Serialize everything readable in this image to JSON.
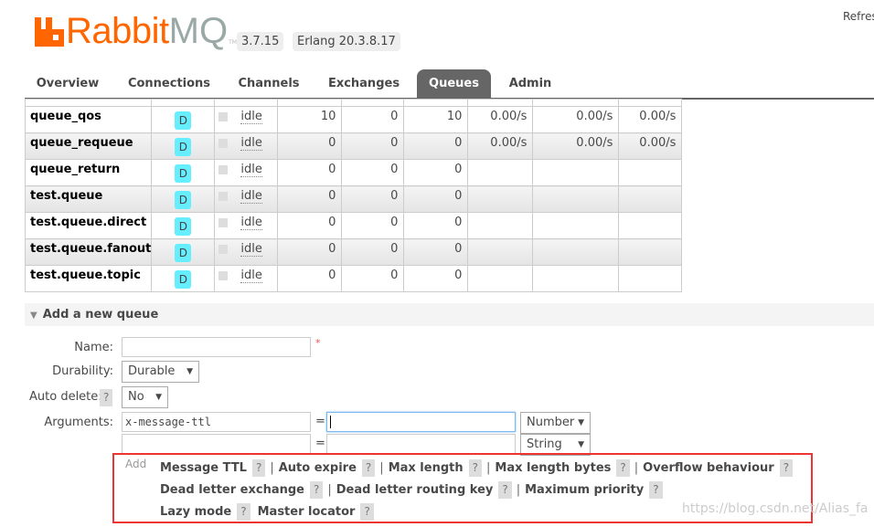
{
  "header": {
    "logo_text": "RabbitMQ",
    "version": "3.7.15",
    "erlang": "Erlang 20.3.8.17",
    "refresh": "Refresh"
  },
  "tabs": [
    {
      "label": "Overview"
    },
    {
      "label": "Connections"
    },
    {
      "label": "Channels"
    },
    {
      "label": "Exchanges"
    },
    {
      "label": "Queues",
      "active": true
    },
    {
      "label": "Admin"
    }
  ],
  "queues": [
    {
      "name": "queue_qos",
      "feature": "D",
      "state": "idle",
      "ready": "10",
      "unacked": "0",
      "total": "10",
      "incoming": "0.00/s",
      "deliver": "0.00/s",
      "ack": "0.00/s"
    },
    {
      "name": "queue_requeue",
      "feature": "D",
      "state": "idle",
      "ready": "0",
      "unacked": "0",
      "total": "0",
      "incoming": "0.00/s",
      "deliver": "0.00/s",
      "ack": "0.00/s"
    },
    {
      "name": "queue_return",
      "feature": "D",
      "state": "idle",
      "ready": "0",
      "unacked": "0",
      "total": "0",
      "incoming": "",
      "deliver": "",
      "ack": ""
    },
    {
      "name": "test.queue",
      "feature": "D",
      "state": "idle",
      "ready": "0",
      "unacked": "0",
      "total": "0",
      "incoming": "",
      "deliver": "",
      "ack": ""
    },
    {
      "name": "test.queue.direct",
      "feature": "D",
      "state": "idle",
      "ready": "0",
      "unacked": "0",
      "total": "0",
      "incoming": "",
      "deliver": "",
      "ack": ""
    },
    {
      "name": "test.queue.fanout",
      "feature": "D",
      "state": "idle",
      "ready": "0",
      "unacked": "0",
      "total": "0",
      "incoming": "",
      "deliver": "",
      "ack": ""
    },
    {
      "name": "test.queue.topic",
      "feature": "D",
      "state": "idle",
      "ready": "0",
      "unacked": "0",
      "total": "0",
      "incoming": "",
      "deliver": "",
      "ack": ""
    }
  ],
  "add_queue": {
    "title": "Add a new queue",
    "name_label": "Name:",
    "name_value": "",
    "required": "*",
    "durability_label": "Durability:",
    "durability_value": "Durable",
    "auto_delete_label": "Auto delete:",
    "auto_delete_value": "No",
    "help": "?",
    "arguments_label": "Arguments:",
    "args": [
      {
        "key": "x-message-ttl",
        "value": "",
        "type": "Number"
      },
      {
        "key": "",
        "value": "",
        "type": "String"
      }
    ],
    "eq": "=",
    "add_label": "Add",
    "shortcuts": [
      [
        "Message TTL",
        "Auto expire",
        "Max length",
        "Max length bytes",
        "Overflow behaviour"
      ],
      [
        "Dead letter exchange",
        "Dead letter routing key",
        "Maximum priority"
      ],
      [
        "Lazy mode",
        "Master locator"
      ]
    ],
    "separator": "|"
  },
  "watermark": "https://blog.csdn.net/Alias_fa",
  "colors": {
    "brand": "#ff6600",
    "tab_active": "#666666",
    "feature_tag": "#66eeff",
    "highlight_box": "#ee3333"
  }
}
